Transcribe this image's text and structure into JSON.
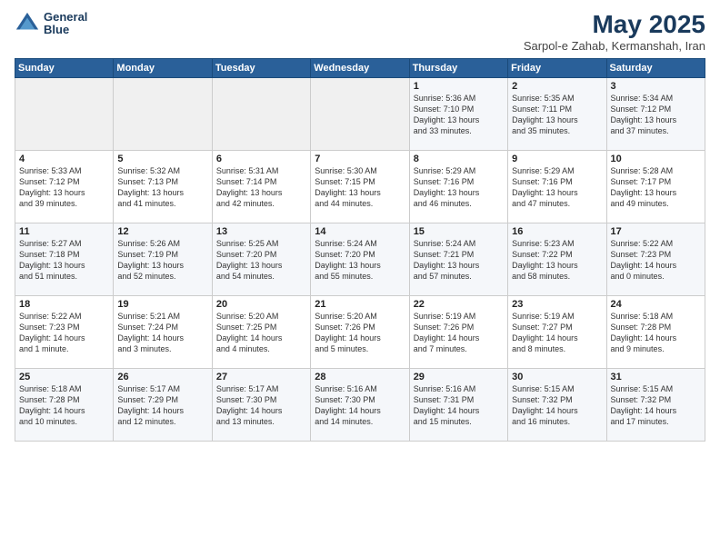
{
  "header": {
    "logo_line1": "General",
    "logo_line2": "Blue",
    "month": "May 2025",
    "location": "Sarpol-e Zahab, Kermanshah, Iran"
  },
  "weekdays": [
    "Sunday",
    "Monday",
    "Tuesday",
    "Wednesday",
    "Thursday",
    "Friday",
    "Saturday"
  ],
  "weeks": [
    [
      {
        "day": "",
        "text": ""
      },
      {
        "day": "",
        "text": ""
      },
      {
        "day": "",
        "text": ""
      },
      {
        "day": "",
        "text": ""
      },
      {
        "day": "1",
        "text": "Sunrise: 5:36 AM\nSunset: 7:10 PM\nDaylight: 13 hours\nand 33 minutes."
      },
      {
        "day": "2",
        "text": "Sunrise: 5:35 AM\nSunset: 7:11 PM\nDaylight: 13 hours\nand 35 minutes."
      },
      {
        "day": "3",
        "text": "Sunrise: 5:34 AM\nSunset: 7:12 PM\nDaylight: 13 hours\nand 37 minutes."
      }
    ],
    [
      {
        "day": "4",
        "text": "Sunrise: 5:33 AM\nSunset: 7:12 PM\nDaylight: 13 hours\nand 39 minutes."
      },
      {
        "day": "5",
        "text": "Sunrise: 5:32 AM\nSunset: 7:13 PM\nDaylight: 13 hours\nand 41 minutes."
      },
      {
        "day": "6",
        "text": "Sunrise: 5:31 AM\nSunset: 7:14 PM\nDaylight: 13 hours\nand 42 minutes."
      },
      {
        "day": "7",
        "text": "Sunrise: 5:30 AM\nSunset: 7:15 PM\nDaylight: 13 hours\nand 44 minutes."
      },
      {
        "day": "8",
        "text": "Sunrise: 5:29 AM\nSunset: 7:16 PM\nDaylight: 13 hours\nand 46 minutes."
      },
      {
        "day": "9",
        "text": "Sunrise: 5:29 AM\nSunset: 7:16 PM\nDaylight: 13 hours\nand 47 minutes."
      },
      {
        "day": "10",
        "text": "Sunrise: 5:28 AM\nSunset: 7:17 PM\nDaylight: 13 hours\nand 49 minutes."
      }
    ],
    [
      {
        "day": "11",
        "text": "Sunrise: 5:27 AM\nSunset: 7:18 PM\nDaylight: 13 hours\nand 51 minutes."
      },
      {
        "day": "12",
        "text": "Sunrise: 5:26 AM\nSunset: 7:19 PM\nDaylight: 13 hours\nand 52 minutes."
      },
      {
        "day": "13",
        "text": "Sunrise: 5:25 AM\nSunset: 7:20 PM\nDaylight: 13 hours\nand 54 minutes."
      },
      {
        "day": "14",
        "text": "Sunrise: 5:24 AM\nSunset: 7:20 PM\nDaylight: 13 hours\nand 55 minutes."
      },
      {
        "day": "15",
        "text": "Sunrise: 5:24 AM\nSunset: 7:21 PM\nDaylight: 13 hours\nand 57 minutes."
      },
      {
        "day": "16",
        "text": "Sunrise: 5:23 AM\nSunset: 7:22 PM\nDaylight: 13 hours\nand 58 minutes."
      },
      {
        "day": "17",
        "text": "Sunrise: 5:22 AM\nSunset: 7:23 PM\nDaylight: 14 hours\nand 0 minutes."
      }
    ],
    [
      {
        "day": "18",
        "text": "Sunrise: 5:22 AM\nSunset: 7:23 PM\nDaylight: 14 hours\nand 1 minute."
      },
      {
        "day": "19",
        "text": "Sunrise: 5:21 AM\nSunset: 7:24 PM\nDaylight: 14 hours\nand 3 minutes."
      },
      {
        "day": "20",
        "text": "Sunrise: 5:20 AM\nSunset: 7:25 PM\nDaylight: 14 hours\nand 4 minutes."
      },
      {
        "day": "21",
        "text": "Sunrise: 5:20 AM\nSunset: 7:26 PM\nDaylight: 14 hours\nand 5 minutes."
      },
      {
        "day": "22",
        "text": "Sunrise: 5:19 AM\nSunset: 7:26 PM\nDaylight: 14 hours\nand 7 minutes."
      },
      {
        "day": "23",
        "text": "Sunrise: 5:19 AM\nSunset: 7:27 PM\nDaylight: 14 hours\nand 8 minutes."
      },
      {
        "day": "24",
        "text": "Sunrise: 5:18 AM\nSunset: 7:28 PM\nDaylight: 14 hours\nand 9 minutes."
      }
    ],
    [
      {
        "day": "25",
        "text": "Sunrise: 5:18 AM\nSunset: 7:28 PM\nDaylight: 14 hours\nand 10 minutes."
      },
      {
        "day": "26",
        "text": "Sunrise: 5:17 AM\nSunset: 7:29 PM\nDaylight: 14 hours\nand 12 minutes."
      },
      {
        "day": "27",
        "text": "Sunrise: 5:17 AM\nSunset: 7:30 PM\nDaylight: 14 hours\nand 13 minutes."
      },
      {
        "day": "28",
        "text": "Sunrise: 5:16 AM\nSunset: 7:30 PM\nDaylight: 14 hours\nand 14 minutes."
      },
      {
        "day": "29",
        "text": "Sunrise: 5:16 AM\nSunset: 7:31 PM\nDaylight: 14 hours\nand 15 minutes."
      },
      {
        "day": "30",
        "text": "Sunrise: 5:15 AM\nSunset: 7:32 PM\nDaylight: 14 hours\nand 16 minutes."
      },
      {
        "day": "31",
        "text": "Sunrise: 5:15 AM\nSunset: 7:32 PM\nDaylight: 14 hours\nand 17 minutes."
      }
    ]
  ]
}
